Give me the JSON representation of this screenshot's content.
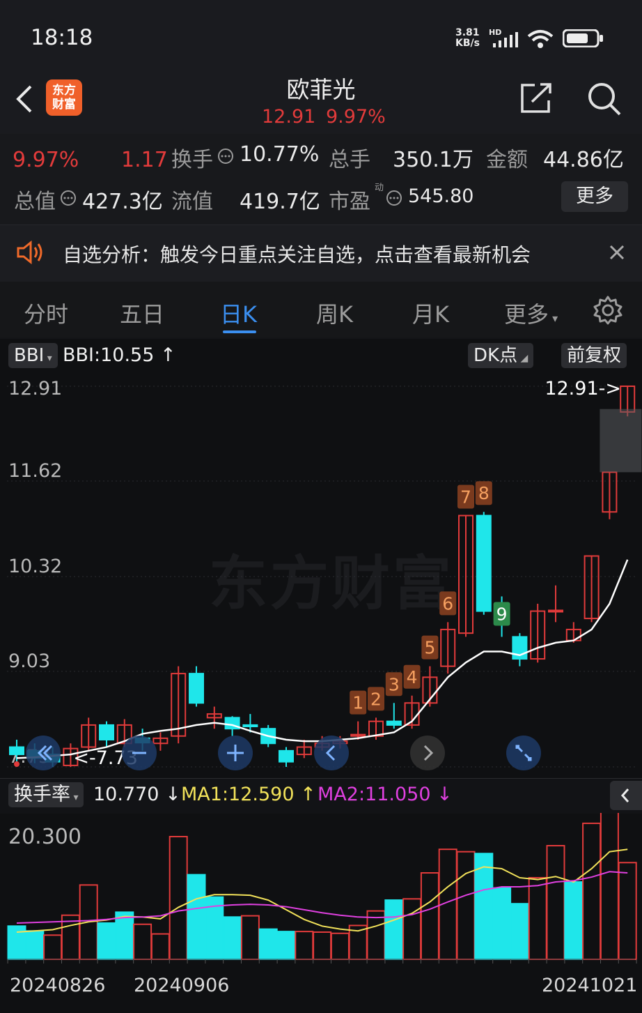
{
  "status": {
    "time": "18:18",
    "net_speed": "3.81",
    "net_unit": "KB/s",
    "hd": "HD"
  },
  "header": {
    "logo_line1": "东方",
    "logo_line2": "财富",
    "title": "欧菲光",
    "price": "12.91",
    "change_pct": "9.97%"
  },
  "quote": {
    "row1": {
      "pct": "9.97%",
      "chg": "1.17",
      "turnover_label": "换手",
      "turnover": "10.77%",
      "vol_label": "总手",
      "vol": "350.1万",
      "amt_label": "金额",
      "amt": "44.86亿"
    },
    "row2": {
      "mcap_label": "总值",
      "mcap": "427.3亿",
      "float_label": "流值",
      "float": "419.7亿",
      "pe_label": "市盈",
      "pe_sup": "动",
      "pe": "545.80",
      "more": "更多"
    }
  },
  "notice": {
    "text": "自选分析：触发今日重点关注自选，点击查看最新机会"
  },
  "tabs": [
    "分时",
    "五日",
    "日K",
    "周K",
    "月K",
    "更多"
  ],
  "chart_toolbar": {
    "indicator": "BBI",
    "indicator_value": "BBI:10.55",
    "dk_label": "DK点",
    "adjust_label": "前复权"
  },
  "watermark": "东方财富",
  "lower_toolbar": {
    "indicator": "换手率",
    "value": "10.770",
    "ma1": "MA1:12.590",
    "ma2": "MA2:11.050"
  },
  "colors": {
    "up": "#e23b3b",
    "down": "#1fe6ea",
    "ma1": "#f2e25a",
    "ma2": "#e040e0",
    "bbi": "#ffffff"
  },
  "chart_data": [
    {
      "type": "candlestick",
      "y_ticks": [
        "12.91",
        "11.62",
        "10.32",
        "9.03",
        "7.73"
      ],
      "ylim": [
        7.73,
        12.91
      ],
      "high_marker": "12.91->",
      "low_marker": "<-7.73",
      "td_labels": [
        "1",
        "2",
        "3",
        "4",
        "5",
        "6",
        "7",
        "8",
        "9"
      ],
      "candles": [
        {
          "o": 8.0,
          "c": 7.9,
          "h": 8.1,
          "l": 7.8
        },
        {
          "o": 7.95,
          "c": 7.85,
          "h": 8.05,
          "l": 7.78
        },
        {
          "o": 7.9,
          "c": 7.8,
          "h": 8.0,
          "l": 7.73
        },
        {
          "o": 7.75,
          "c": 7.98,
          "h": 8.05,
          "l": 7.73
        },
        {
          "o": 8.0,
          "c": 8.3,
          "h": 8.4,
          "l": 7.95
        },
        {
          "o": 8.3,
          "c": 8.1,
          "h": 8.35,
          "l": 8.0
        },
        {
          "o": 8.05,
          "c": 8.3,
          "h": 8.38,
          "l": 8.0
        },
        {
          "o": 8.12,
          "c": 8.06,
          "h": 8.25,
          "l": 7.95
        },
        {
          "o": 8.05,
          "c": 8.12,
          "h": 8.2,
          "l": 7.95
        },
        {
          "o": 8.15,
          "c": 9.0,
          "h": 9.1,
          "l": 8.05
        },
        {
          "o": 9.0,
          "c": 8.6,
          "h": 9.1,
          "l": 8.55
        },
        {
          "o": 8.4,
          "c": 8.45,
          "h": 8.55,
          "l": 8.25
        },
        {
          "o": 8.4,
          "c": 8.25,
          "h": 8.42,
          "l": 8.15
        },
        {
          "o": 8.3,
          "c": 8.28,
          "h": 8.45,
          "l": 8.2
        },
        {
          "o": 8.25,
          "c": 8.05,
          "h": 8.3,
          "l": 8.0
        },
        {
          "o": 7.95,
          "c": 7.8,
          "h": 8.0,
          "l": 7.73
        },
        {
          "o": 7.9,
          "c": 8.0,
          "h": 8.1,
          "l": 7.85
        },
        {
          "o": 8.0,
          "c": 8.05,
          "h": 8.15,
          "l": 7.95
        },
        {
          "o": 8.05,
          "c": 8.08,
          "h": 8.15,
          "l": 7.98
        },
        {
          "o": 8.15,
          "c": 8.17,
          "h": 8.35,
          "l": 8.1
        },
        {
          "o": 8.15,
          "c": 8.35,
          "h": 8.4,
          "l": 8.1
        },
        {
          "o": 8.35,
          "c": 8.3,
          "h": 8.6,
          "l": 8.25
        },
        {
          "o": 8.3,
          "c": 8.6,
          "h": 8.7,
          "l": 8.25
        },
        {
          "o": 8.6,
          "c": 8.95,
          "h": 9.1,
          "l": 8.55
        },
        {
          "o": 9.1,
          "c": 9.6,
          "h": 9.7,
          "l": 9.0
        },
        {
          "o": 9.55,
          "c": 11.15,
          "h": 11.15,
          "l": 9.5
        },
        {
          "o": 11.15,
          "c": 9.85,
          "h": 11.2,
          "l": 9.8
        },
        {
          "o": 9.85,
          "c": 9.7,
          "h": 10.05,
          "l": 9.5
        },
        {
          "o": 9.5,
          "c": 9.2,
          "h": 9.55,
          "l": 9.1
        },
        {
          "o": 9.2,
          "c": 9.85,
          "h": 9.95,
          "l": 9.15
        },
        {
          "o": 9.85,
          "c": 9.86,
          "h": 10.2,
          "l": 9.7
        },
        {
          "o": 9.45,
          "c": 9.6,
          "h": 9.7,
          "l": 9.42
        },
        {
          "o": 9.75,
          "c": 10.6,
          "h": 10.6,
          "l": 9.7
        },
        {
          "o": 11.2,
          "c": 11.74,
          "h": 11.74,
          "l": 11.1
        },
        {
          "o": 12.56,
          "c": 12.91,
          "h": 12.91,
          "l": 12.5
        }
      ],
      "bbi": [
        7.85,
        7.86,
        7.88,
        7.9,
        7.95,
        8.0,
        8.08,
        8.18,
        8.22,
        8.25,
        8.3,
        8.33,
        8.3,
        8.22,
        8.15,
        8.1,
        8.08,
        8.08,
        8.1,
        8.12,
        8.16,
        8.2,
        8.35,
        8.65,
        8.95,
        9.15,
        9.3,
        9.3,
        9.25,
        9.35,
        9.42,
        9.45,
        9.6,
        9.95,
        10.55
      ]
    },
    {
      "type": "bar",
      "ylabel_top": "20.300",
      "ylim": [
        0,
        20.3
      ],
      "x_ticks": [
        "20240826",
        "20240906",
        "20241021"
      ],
      "values": [
        5.5,
        4.7,
        4.0,
        7.3,
        12.3,
        6.0,
        7.8,
        5.8,
        4.2,
        20.3,
        14.0,
        10.3,
        7.0,
        7.2,
        5.0,
        4.6,
        4.6,
        4.5,
        4.3,
        5.6,
        8.0,
        9.8,
        10.0,
        14.3,
        18.2,
        17.8,
        17.5,
        11.8,
        9.2,
        13.5,
        18.8,
        12.8,
        22.5,
        25.8,
        16.0
      ],
      "up": [
        0,
        0,
        1,
        1,
        1,
        0,
        0,
        1,
        1,
        1,
        0,
        0,
        0,
        1,
        0,
        0,
        1,
        1,
        1,
        1,
        1,
        0,
        1,
        1,
        1,
        1,
        0,
        0,
        0,
        1,
        1,
        0,
        1,
        1,
        1
      ],
      "ma1": [
        4.5,
        4.7,
        4.9,
        5.6,
        6.2,
        6.5,
        7.1,
        7.0,
        6.7,
        8.6,
        10.0,
        10.7,
        10.7,
        10.6,
        9.8,
        8.2,
        6.6,
        5.5,
        5.0,
        4.7,
        5.5,
        6.5,
        7.6,
        9.5,
        12.0,
        14.2,
        15.3,
        15.0,
        13.5,
        13.2,
        13.7,
        12.8,
        15.0,
        17.8,
        18.2
      ],
      "ma2": [
        6.0,
        6.1,
        6.2,
        6.3,
        6.4,
        6.6,
        6.9,
        7.0,
        7.2,
        8.0,
        8.4,
        8.8,
        9.0,
        9.1,
        9.0,
        8.7,
        8.2,
        7.7,
        7.3,
        7.0,
        6.9,
        7.0,
        7.4,
        8.3,
        9.5,
        10.6,
        11.5,
        12.0,
        12.0,
        12.2,
        12.8,
        13.0,
        13.6,
        14.5,
        14.3
      ]
    }
  ]
}
